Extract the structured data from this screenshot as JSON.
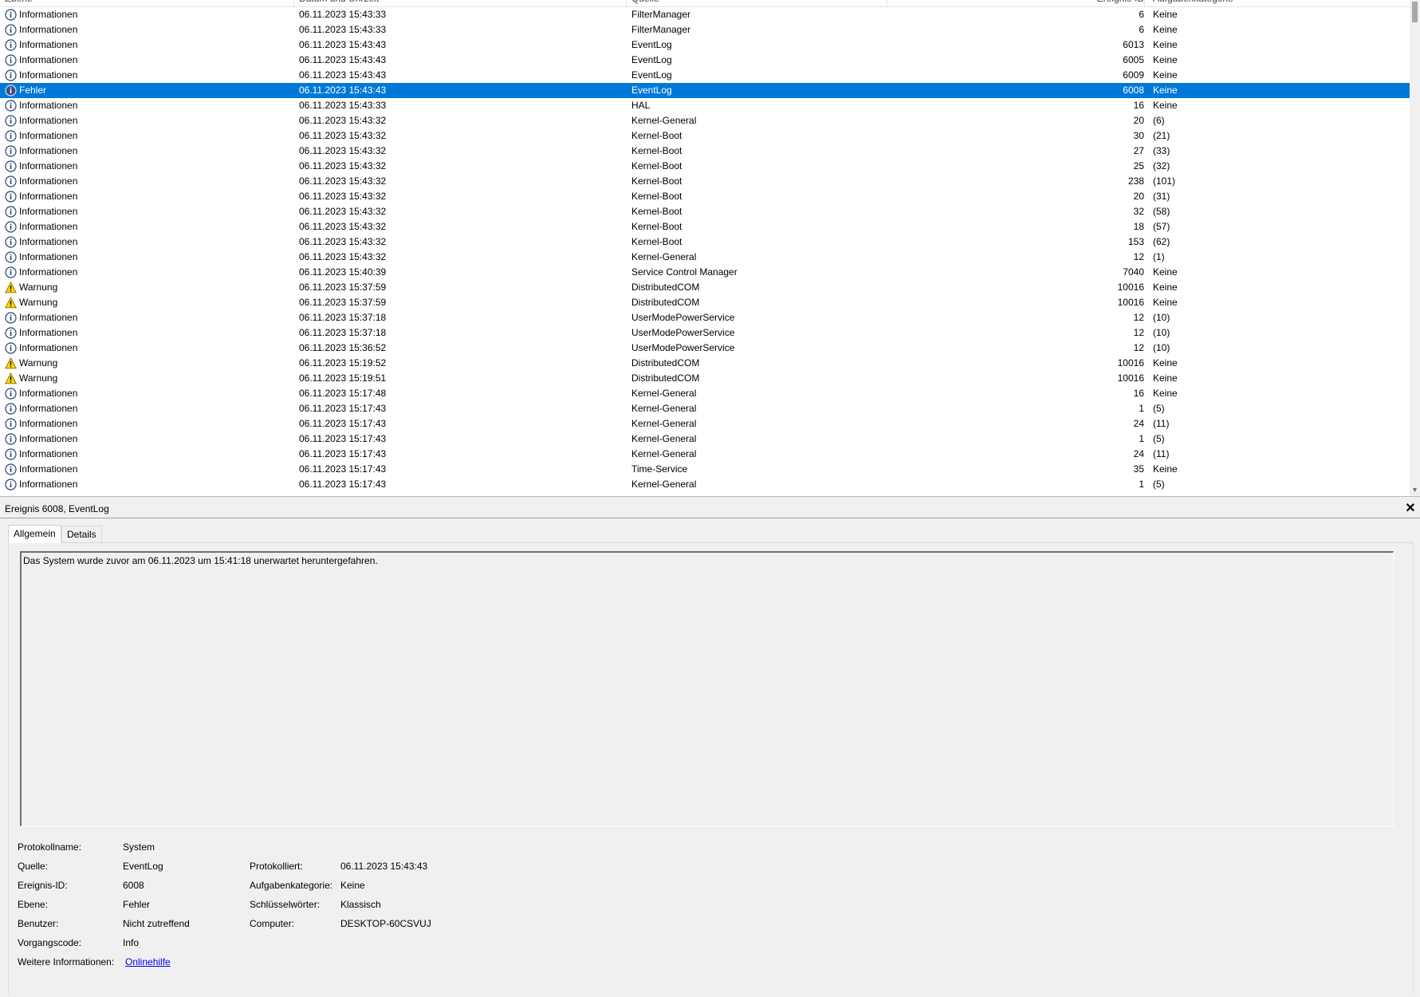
{
  "list": {
    "columns": [
      "Ebene",
      "Datum und Uhrzeit",
      "Quelle",
      "Ereignis-ID",
      "Aufgabenkategorie"
    ],
    "rows": [
      {
        "level": "Informationen",
        "icon": "info",
        "date": "06.11.2023 15:43:33",
        "source": "FilterManager",
        "id": "6",
        "category": "Keine"
      },
      {
        "level": "Informationen",
        "icon": "info",
        "date": "06.11.2023 15:43:33",
        "source": "FilterManager",
        "id": "6",
        "category": "Keine"
      },
      {
        "level": "Informationen",
        "icon": "info",
        "date": "06.11.2023 15:43:43",
        "source": "EventLog",
        "id": "6013",
        "category": "Keine"
      },
      {
        "level": "Informationen",
        "icon": "info",
        "date": "06.11.2023 15:43:43",
        "source": "EventLog",
        "id": "6005",
        "category": "Keine"
      },
      {
        "level": "Informationen",
        "icon": "info",
        "date": "06.11.2023 15:43:43",
        "source": "EventLog",
        "id": "6009",
        "category": "Keine"
      },
      {
        "level": "Fehler",
        "icon": "info",
        "date": "06.11.2023 15:43:43",
        "source": "EventLog",
        "id": "6008",
        "category": "Keine",
        "selected": true
      },
      {
        "level": "Informationen",
        "icon": "info",
        "date": "06.11.2023 15:43:33",
        "source": "HAL",
        "id": "16",
        "category": "Keine"
      },
      {
        "level": "Informationen",
        "icon": "info",
        "date": "06.11.2023 15:43:32",
        "source": "Kernel-General",
        "id": "20",
        "category": "(6)"
      },
      {
        "level": "Informationen",
        "icon": "info",
        "date": "06.11.2023 15:43:32",
        "source": "Kernel-Boot",
        "id": "30",
        "category": "(21)"
      },
      {
        "level": "Informationen",
        "icon": "info",
        "date": "06.11.2023 15:43:32",
        "source": "Kernel-Boot",
        "id": "27",
        "category": "(33)"
      },
      {
        "level": "Informationen",
        "icon": "info",
        "date": "06.11.2023 15:43:32",
        "source": "Kernel-Boot",
        "id": "25",
        "category": "(32)"
      },
      {
        "level": "Informationen",
        "icon": "info",
        "date": "06.11.2023 15:43:32",
        "source": "Kernel-Boot",
        "id": "238",
        "category": "(101)"
      },
      {
        "level": "Informationen",
        "icon": "info",
        "date": "06.11.2023 15:43:32",
        "source": "Kernel-Boot",
        "id": "20",
        "category": "(31)"
      },
      {
        "level": "Informationen",
        "icon": "info",
        "date": "06.11.2023 15:43:32",
        "source": "Kernel-Boot",
        "id": "32",
        "category": "(58)"
      },
      {
        "level": "Informationen",
        "icon": "info",
        "date": "06.11.2023 15:43:32",
        "source": "Kernel-Boot",
        "id": "18",
        "category": "(57)"
      },
      {
        "level": "Informationen",
        "icon": "info",
        "date": "06.11.2023 15:43:32",
        "source": "Kernel-Boot",
        "id": "153",
        "category": "(62)"
      },
      {
        "level": "Informationen",
        "icon": "info",
        "date": "06.11.2023 15:43:32",
        "source": "Kernel-General",
        "id": "12",
        "category": "(1)"
      },
      {
        "level": "Informationen",
        "icon": "info",
        "date": "06.11.2023 15:40:39",
        "source": "Service Control Manager",
        "id": "7040",
        "category": "Keine"
      },
      {
        "level": "Warnung",
        "icon": "warning",
        "date": "06.11.2023 15:37:59",
        "source": "DistributedCOM",
        "id": "10016",
        "category": "Keine"
      },
      {
        "level": "Warnung",
        "icon": "warning",
        "date": "06.11.2023 15:37:59",
        "source": "DistributedCOM",
        "id": "10016",
        "category": "Keine"
      },
      {
        "level": "Informationen",
        "icon": "info",
        "date": "06.11.2023 15:37:18",
        "source": "UserModePowerService",
        "id": "12",
        "category": "(10)"
      },
      {
        "level": "Informationen",
        "icon": "info",
        "date": "06.11.2023 15:37:18",
        "source": "UserModePowerService",
        "id": "12",
        "category": "(10)"
      },
      {
        "level": "Informationen",
        "icon": "info",
        "date": "06.11.2023 15:36:52",
        "source": "UserModePowerService",
        "id": "12",
        "category": "(10)"
      },
      {
        "level": "Warnung",
        "icon": "warning",
        "date": "06.11.2023 15:19:52",
        "source": "DistributedCOM",
        "id": "10016",
        "category": "Keine"
      },
      {
        "level": "Warnung",
        "icon": "warning",
        "date": "06.11.2023 15:19:51",
        "source": "DistributedCOM",
        "id": "10016",
        "category": "Keine"
      },
      {
        "level": "Informationen",
        "icon": "info",
        "date": "06.11.2023 15:17:48",
        "source": "Kernel-General",
        "id": "16",
        "category": "Keine"
      },
      {
        "level": "Informationen",
        "icon": "info",
        "date": "06.11.2023 15:17:43",
        "source": "Kernel-General",
        "id": "1",
        "category": "(5)"
      },
      {
        "level": "Informationen",
        "icon": "info",
        "date": "06.11.2023 15:17:43",
        "source": "Kernel-General",
        "id": "24",
        "category": "(11)"
      },
      {
        "level": "Informationen",
        "icon": "info",
        "date": "06.11.2023 15:17:43",
        "source": "Kernel-General",
        "id": "1",
        "category": "(5)"
      },
      {
        "level": "Informationen",
        "icon": "info",
        "date": "06.11.2023 15:17:43",
        "source": "Kernel-General",
        "id": "24",
        "category": "(11)"
      },
      {
        "level": "Informationen",
        "icon": "info",
        "date": "06.11.2023 15:17:43",
        "source": "Time-Service",
        "id": "35",
        "category": "Keine"
      },
      {
        "level": "Informationen",
        "icon": "info",
        "date": "06.11.2023 15:17:43",
        "source": "Kernel-General",
        "id": "1",
        "category": "(5)"
      }
    ]
  },
  "detail": {
    "title": "Ereignis 6008, EventLog",
    "close_icon": "close-icon",
    "tabs": [
      {
        "label": "Allgemein",
        "active": true
      },
      {
        "label": "Details",
        "active": false
      }
    ],
    "message": "Das System wurde zuvor am 06.11.2023 um 15:41:18 unerwartet heruntergefahren.",
    "props": {
      "protokollname_label": "Protokollname:",
      "protokollname_value": "System",
      "quelle_label": "Quelle:",
      "quelle_value": "EventLog",
      "protokolliert_label": "Protokolliert:",
      "protokolliert_value": "06.11.2023 15:43:43",
      "ereignis_id_label": "Ereignis-ID:",
      "ereignis_id_value": "6008",
      "aufgabenkategorie_label": "Aufgabenkategorie:",
      "aufgabenkategorie_value": "Keine",
      "ebene_label": "Ebene:",
      "ebene_value": "Fehler",
      "schluesselwoerter_label": "Schlüsselwörter:",
      "schluesselwoerter_value": "Klassisch",
      "benutzer_label": "Benutzer:",
      "benutzer_value": "Nicht zutreffend",
      "computer_label": "Computer:",
      "computer_value": "DESKTOP-60CSVUJ",
      "vorgangscode_label": "Vorgangscode:",
      "vorgangscode_value": "Info",
      "weitere_label": "Weitere Informationen:",
      "weitere_link": "Onlinehilfe"
    }
  },
  "colors": {
    "selection": "#0078d7",
    "warning_icon": "#ffd700",
    "info_icon": "#1f3f8f",
    "link": "#0000ee"
  }
}
